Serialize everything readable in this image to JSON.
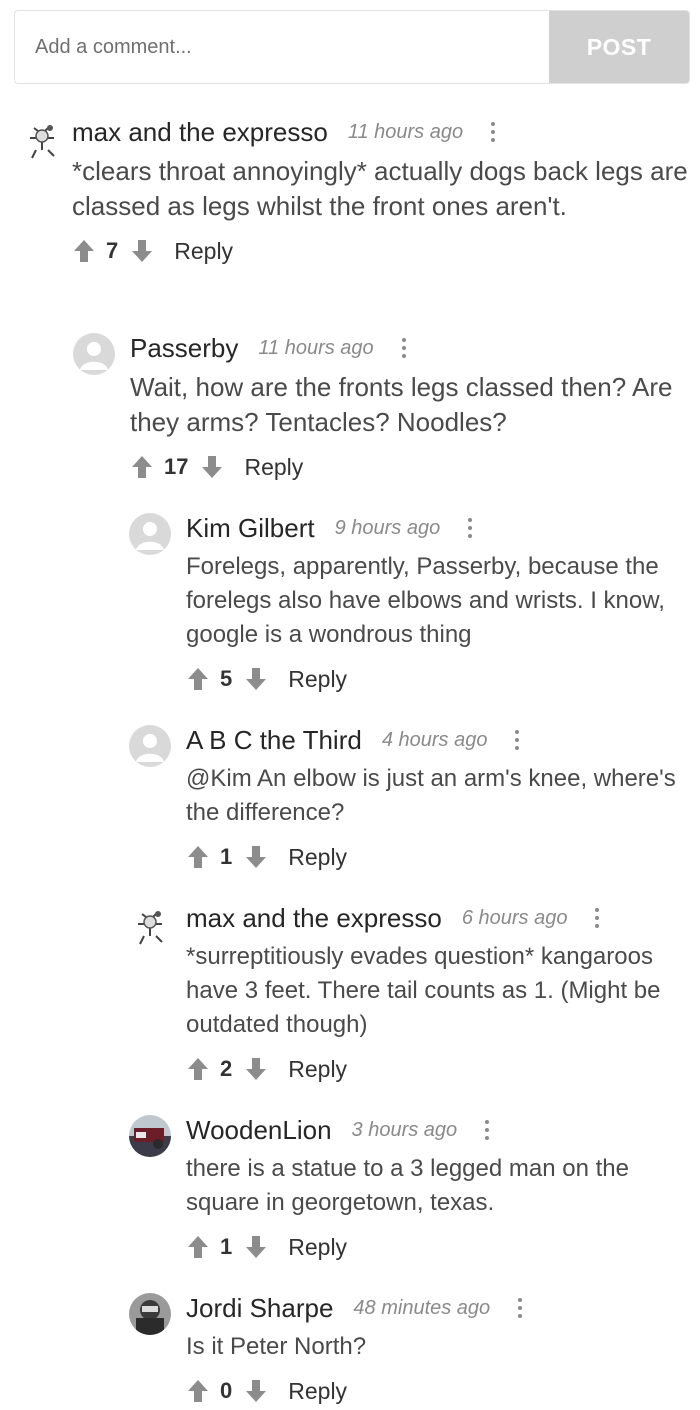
{
  "comment_box": {
    "placeholder": "Add a comment...",
    "post_label": "POST"
  },
  "comments": [
    {
      "author": "max and the expresso",
      "time": "11 hours ago",
      "text": "*clears throat annoyingly* actually dogs back legs are classed as legs whilst the front ones aren't.",
      "votes": "7",
      "reply_label": "Reply",
      "avatar": "cow-bird-avatar"
    },
    {
      "author": "Passerby",
      "time": "11 hours ago",
      "text": "Wait, how are the fronts legs classed then? Are they arms? Tentacles? Noodles?",
      "votes": "17",
      "reply_label": "Reply",
      "avatar": "default-user-avatar"
    },
    {
      "author": "Kim Gilbert",
      "time": "9 hours ago",
      "text": "Forelegs, apparently, Passerby, because the forelegs also have elbows and wrists. I know, google is a wondrous thing",
      "votes": "5",
      "reply_label": "Reply",
      "avatar": "default-user-avatar"
    },
    {
      "author": "A B C the Third",
      "time": "4 hours ago",
      "text": "@Kim An elbow is just an arm's knee, where's the difference?",
      "votes": "1",
      "reply_label": "Reply",
      "avatar": "default-user-avatar"
    },
    {
      "author": "max and the expresso",
      "time": "6 hours ago",
      "text": "*surreptitiously evades question* kangaroos have 3 feet. There tail counts as 1. (Might be outdated though)",
      "votes": "2",
      "reply_label": "Reply",
      "avatar": "cow-bird-avatar"
    },
    {
      "author": "WoodenLion",
      "time": "3 hours ago",
      "text": "there is a statue to a 3 legged man on the square in georgetown, texas.",
      "votes": "1",
      "reply_label": "Reply",
      "avatar": "photo-avatar"
    },
    {
      "author": "Jordi Sharpe",
      "time": "48 minutes ago",
      "text": "Is it Peter North?",
      "votes": "0",
      "reply_label": "Reply",
      "avatar": "photo-avatar-2"
    }
  ]
}
